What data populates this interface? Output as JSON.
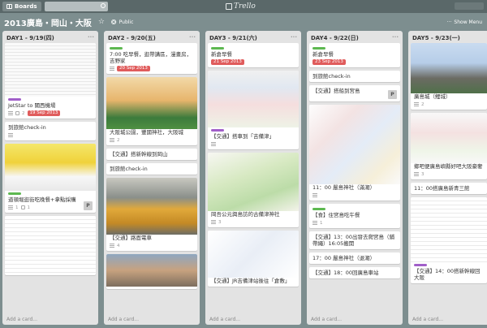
{
  "topbar": {
    "boards_label": "Boards",
    "logo_text": "Trello"
  },
  "board": {
    "title": "2013廣島・岡山・大阪",
    "visibility": "Public",
    "show_menu": "Show Menu"
  },
  "icons": {
    "star": "star-icon",
    "globe": "globe-icon",
    "search": "search-icon"
  },
  "colors": {
    "label_green": "#5db850",
    "label_purple": "#a15fc9",
    "label_orange": "#e88d2f",
    "due_red": "#e05c5c"
  },
  "add_card_label": "Add a card...",
  "lists": [
    {
      "title": "DAY1 - 9/19(四)",
      "cards": [
        {
          "text": "JetStar to 關西機場",
          "badges": [
            "2",
            "0/4"
          ],
          "due": "19 Sep 2013"
        },
        {
          "text": "到旅館check-in",
          "badges": []
        },
        {
          "text": "道頓堀逛街吃晚餐+拿點採購",
          "badges": [
            "1",
            "1"
          ],
          "member": "P"
        }
      ]
    },
    {
      "title": "DAY2 - 9/20(五)",
      "cards": [
        {
          "text": "7:00 吃早餐，逛帶講區，漫畫房，吉野家",
          "due": "20 Sep 2013"
        },
        {
          "text": "大阪城公園，豐國神社，大阪城",
          "badges": [
            "2"
          ]
        },
        {
          "text": "【交通】搭新幹線到岡山",
          "badges": []
        },
        {
          "text": "到旅館check-in",
          "badges": []
        },
        {
          "text": "【交通】路面電車",
          "badges": [
            "4"
          ]
        }
      ]
    },
    {
      "title": "DAY3 - 9/21(六)",
      "cards": [
        {
          "text": "新倉早餐",
          "due": "21 Sep 2013"
        },
        {
          "text": "【交通】搭車到「吉備津」",
          "badges": []
        },
        {
          "text": "岡吾公元興島訪的古備津神社",
          "badges": [
            "3"
          ]
        },
        {
          "text": "【交通】JR吉備津站後往「倉敷」"
        }
      ]
    },
    {
      "title": "DAY4 - 9/22(日)",
      "cards": [
        {
          "text": "新倉早餐",
          "due": "23 Sep 2013"
        },
        {
          "text": "到旅館check-in",
          "badges": []
        },
        {
          "text": "【交通】搭船到宮島",
          "member": "P"
        },
        {
          "text": "11：00 嚴島神社（滿潮）",
          "badges": []
        },
        {
          "text": "【食】住宮島吃午餐",
          "badges": [
            "1"
          ]
        },
        {
          "text": "【交通】13：00出發去爬宮島（鋪帶繩）16:05搬開",
          "badges": []
        },
        {
          "text": "17：00 嚴島神社（退潮）",
          "badges": []
        },
        {
          "text": "【交通】18：00回廣島車站"
        }
      ]
    },
    {
      "title": "DAY5 - 9/23(一)",
      "cards": [
        {
          "text": "廣島城（鯉城）",
          "badges": [
            "2"
          ]
        },
        {
          "text": "鄉吧便廣島嶼縣好吧大阪豪奢",
          "badges": [
            "3"
          ]
        },
        {
          "text": "11：00搭廣島新青三館",
          "badges": []
        },
        {
          "text": "【交通】14：00搭新幹線回大阪",
          "badges": []
        }
      ]
    }
  ]
}
